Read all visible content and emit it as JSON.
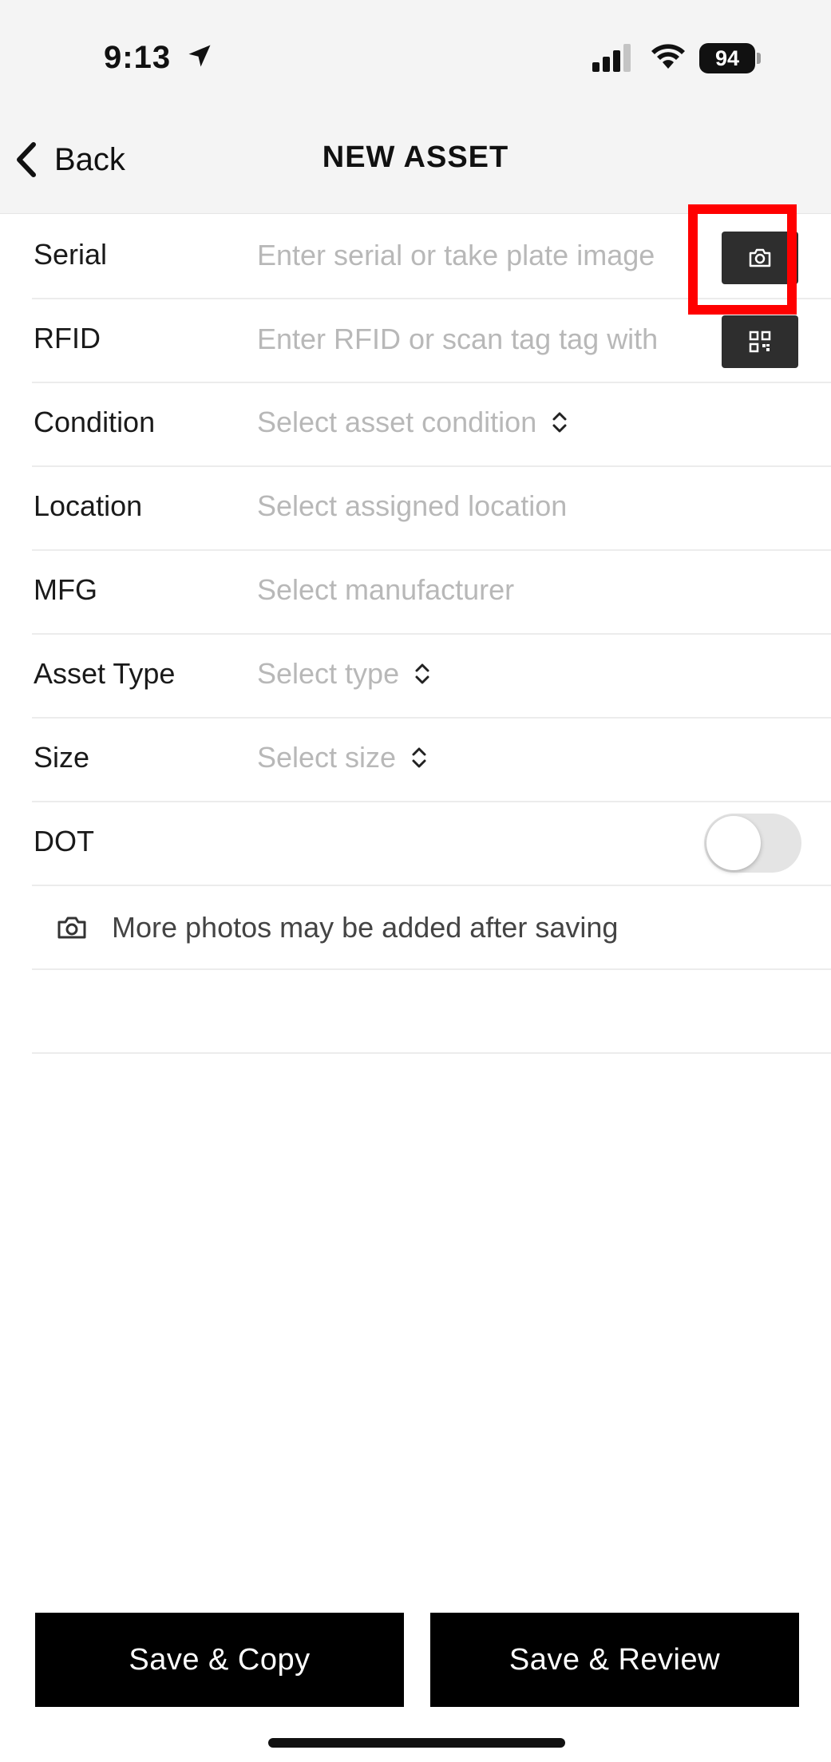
{
  "status_bar": {
    "time": "9:13",
    "battery": "94"
  },
  "nav": {
    "back_label": "Back",
    "title": "NEW ASSET"
  },
  "form": {
    "serial": {
      "label": "Serial",
      "placeholder": "Enter serial or take plate image"
    },
    "rfid": {
      "label": "RFID",
      "placeholder": "Enter RFID or scan tag tag with"
    },
    "condition": {
      "label": "Condition",
      "value": "Select asset condition"
    },
    "location": {
      "label": "Location",
      "value": "Select assigned location"
    },
    "mfg": {
      "label": "MFG",
      "value": "Select manufacturer"
    },
    "asset_type": {
      "label": "Asset Type",
      "value": "Select type"
    },
    "size": {
      "label": "Size",
      "value": "Select size"
    },
    "dot": {
      "label": "DOT",
      "enabled": false
    }
  },
  "photo_note": "More photos may be added after saving",
  "buttons": {
    "save_copy": "Save & Copy",
    "save_review": "Save & Review"
  },
  "colors": {
    "highlight": "#ff0000",
    "button_bg": "#000000",
    "icon_button_bg": "#2e2e2e",
    "placeholder": "#b8b8b8"
  }
}
